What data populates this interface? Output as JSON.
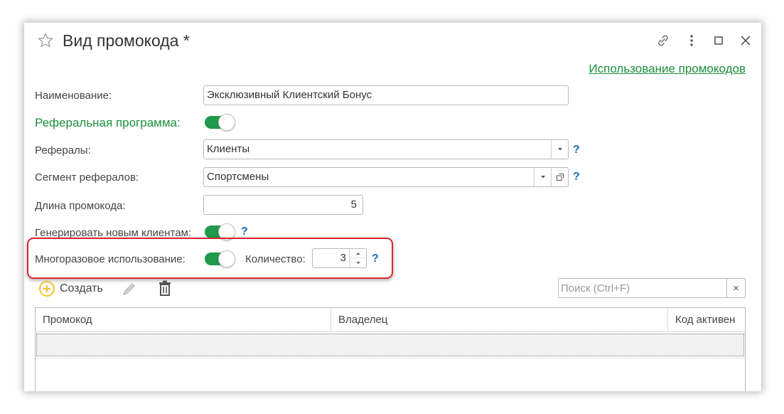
{
  "window": {
    "title": "Вид промокода *",
    "top_link": "Использование промокодов"
  },
  "form": {
    "name_label": "Наименование:",
    "name_value": "Эксклюзивный Клиентский Бонус",
    "referral_label": "Реферальная программа:",
    "referral_on": true,
    "referrals_label": "Рефералы:",
    "referrals_value": "Клиенты",
    "segment_label": "Сегмент рефералов:",
    "segment_value": "Спортсмены",
    "length_label": "Длина промокода:",
    "length_value": "5",
    "generate_label": "Генерировать новым клиентам:",
    "generate_on": true,
    "multi_label": "Многоразовое использование:",
    "multi_on": true,
    "qty_label": "Количество:",
    "qty_value": "3",
    "help": "?"
  },
  "toolbar": {
    "create_label": "Создать",
    "search_placeholder": "Поиск (Ctrl+F)",
    "clear": "×"
  },
  "table": {
    "columns": [
      "Промокод",
      "Владелец",
      "Код активен"
    ]
  },
  "colors": {
    "accent_green": "#1c8f3c",
    "toggle_green": "#1e9a4a",
    "help_blue": "#1a6fb5",
    "highlight_red": "#d9262f",
    "create_icon_yellow": "#f2c12e"
  },
  "icons": [
    "star-icon",
    "link-icon",
    "more-icon",
    "maximize-icon",
    "close-icon",
    "dropdown-arrow-icon",
    "open-form-icon",
    "add-circle-icon",
    "edit-pencil-icon",
    "delete-trash-icon"
  ]
}
